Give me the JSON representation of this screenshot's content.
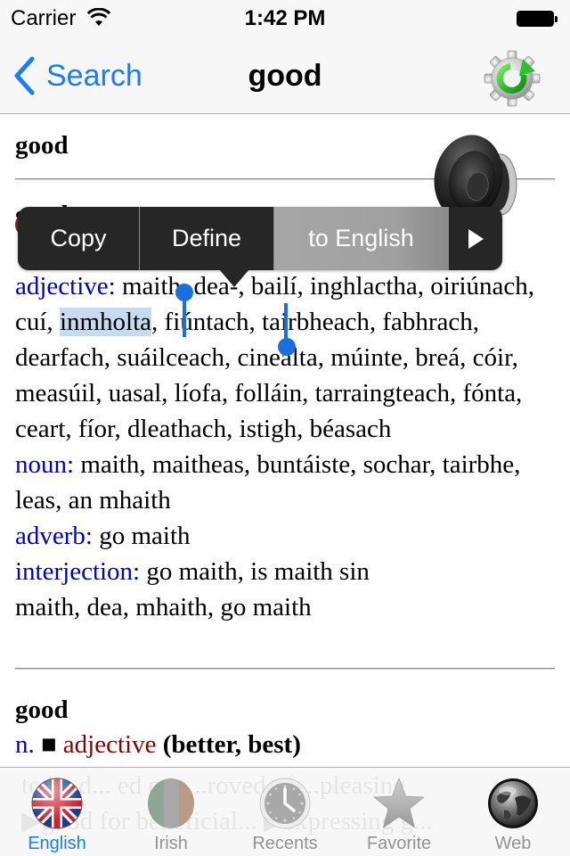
{
  "status_bar": {
    "carrier": "Carrier",
    "time": "1:42 PM",
    "wifi_icon": "wifi-icon",
    "battery_icon": "battery-full-icon"
  },
  "nav_bar": {
    "back_label": "Search",
    "title": "good",
    "right_button_icon": "gear-refresh-icon",
    "tint_color": "#157efb"
  },
  "content": {
    "entry1": {
      "headword": "good",
      "speaker_icon": "speaker-icon"
    },
    "entry2": {
      "headword": "good",
      "definitions": [
        {
          "pos": "adjective:",
          "pre": " maith, dea-, bailí, inghlactha, oiriúnach, cuí, ",
          "selected": "inmholta",
          "post": ", fiúntach, tairbheach, fabhrach, dearfach, suáilceach, cineálta, múinte, breá, cóir, measúil, uasal, líofa, folláin, tarraingteach, fónta, ceart, fíor, dleathach, istigh, béasach"
        },
        {
          "pos": "noun:",
          "text": " maith, maitheas, buntáiste, sochar, tairbhe, leas, an mhaith"
        },
        {
          "pos": "adverb:",
          "text": " go maith"
        },
        {
          "pos": "interjection:",
          "text": " go maith, is maith sin"
        }
      ],
      "extra": "maith, dea, mhaith, go maith"
    },
    "entry3": {
      "headword": "good",
      "abbr": "n.",
      "square": "■",
      "pos": "adjective",
      "forms": "(better, best)",
      "ghost_lines": [
        "to be d... ed or a...roved of ...pleasing",
        "▶good for beneficial... ▶expressing g..."
      ]
    },
    "pos_color": "#0000cc",
    "selection_color": "#c6dbf0"
  },
  "edit_menu": {
    "items": [
      {
        "label": "Copy"
      },
      {
        "label": "Define"
      },
      {
        "label": "to English",
        "highlighted": true
      },
      {
        "label": "",
        "icon": "play-arrow-icon"
      }
    ]
  },
  "tab_bar": {
    "active_color": "#157efb",
    "inactive_color": "#929292",
    "tabs": [
      {
        "label": "English",
        "icon": "uk-flag-icon",
        "active": true
      },
      {
        "label": "Irish",
        "icon": "irish-flag-icon",
        "active": false
      },
      {
        "label": "Recents",
        "icon": "clock-icon",
        "active": false
      },
      {
        "label": "Favorite",
        "icon": "star-icon",
        "active": false
      },
      {
        "label": "Web",
        "icon": "globe-icon",
        "active": false
      }
    ]
  }
}
